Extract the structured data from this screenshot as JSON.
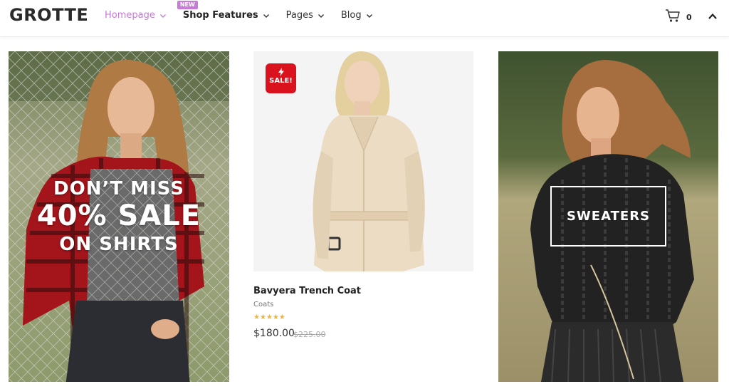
{
  "brand": {
    "logo": "GROTTE"
  },
  "nav": {
    "items": [
      {
        "label": "Homepage",
        "active": true,
        "badge": ""
      },
      {
        "label": "Shop Features",
        "active": false,
        "badge": "NEW"
      },
      {
        "label": "Pages",
        "active": false,
        "badge": ""
      },
      {
        "label": "Blog",
        "active": false,
        "badge": ""
      }
    ]
  },
  "header_actions": {
    "cart_icon": "shopping-cart-icon",
    "cart_count": "0",
    "up_icon": "chevron-up-icon"
  },
  "promo_left": {
    "line1": "DON’T MISS",
    "line2": "40% SALE",
    "line3": "ON SHIRTS"
  },
  "product": {
    "badge": "SALE!",
    "badge_icon": "lightning-icon",
    "name": "Bavyera Trench Coat",
    "category": "Coats",
    "rating_stars": 5,
    "price": "$180.00",
    "old_price": "$225.00"
  },
  "promo_right": {
    "label": "SWEATERS"
  },
  "colors": {
    "accent": "#c77ad8",
    "sale_red": "#d9121e",
    "star": "#e9b44c"
  }
}
